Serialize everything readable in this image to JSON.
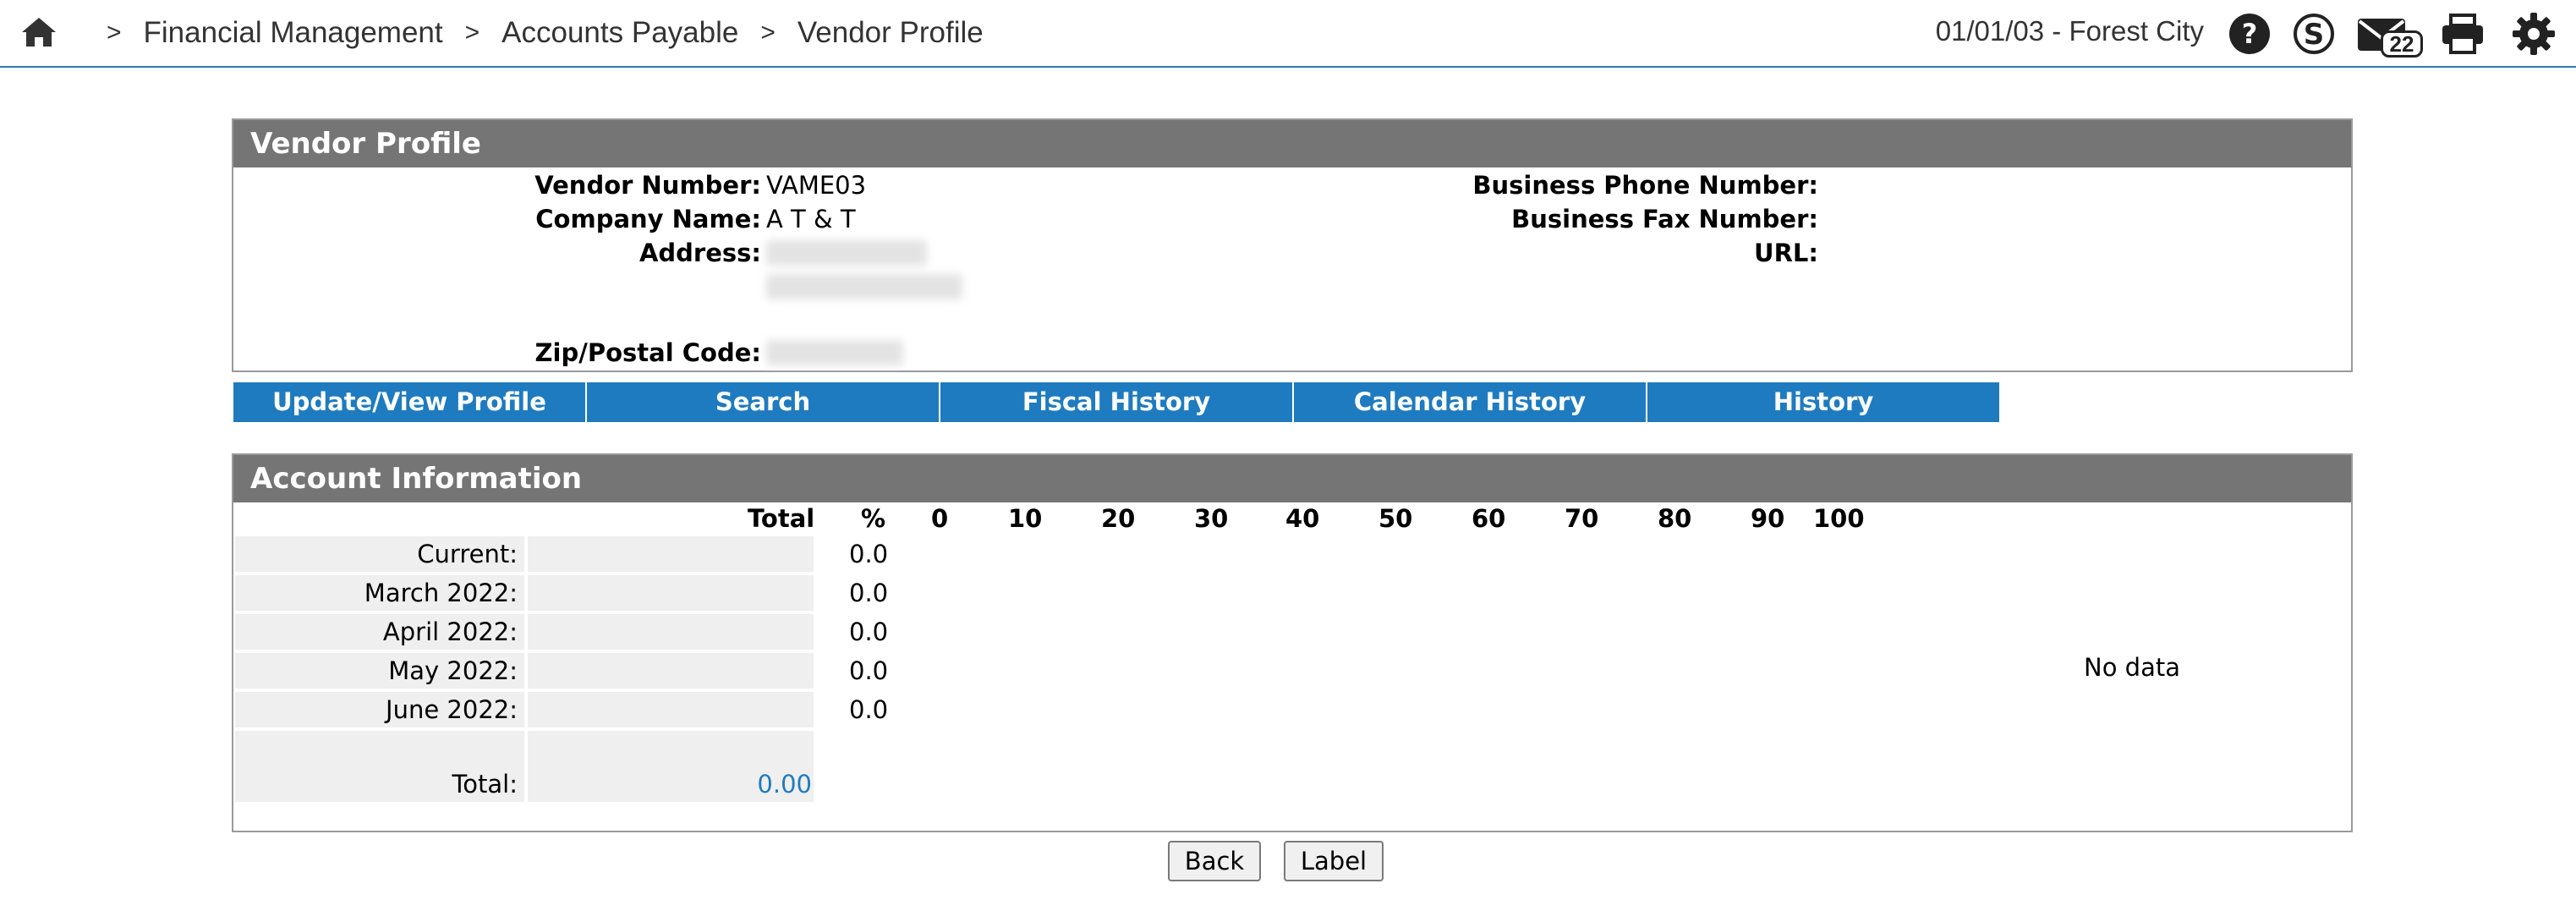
{
  "breadcrumb": {
    "items": [
      "Financial Management",
      "Accounts Payable",
      "Vendor Profile"
    ],
    "separator": ">"
  },
  "header": {
    "location": "01/01/03 - Forest City",
    "mail_count": "22",
    "icons": [
      "home-icon",
      "help-icon",
      "skyward-icon",
      "mail-icon",
      "print-icon",
      "settings-icon"
    ]
  },
  "vendor_profile": {
    "title": "Vendor Profile",
    "vendor_number_label": "Vendor Number:",
    "vendor_number": "VAME03",
    "company_name_label": "Company Name:",
    "company_name": "A T & T",
    "address_label": "Address:",
    "zip_label": "Zip/Postal Code:",
    "business_phone_label": "Business Phone Number:",
    "business_fax_label": "Business Fax Number:",
    "url_label": "URL:"
  },
  "tabs": [
    "Update/View Profile",
    "Search",
    "Fiscal History",
    "Calendar History",
    "History"
  ],
  "account_info": {
    "title": "Account Information",
    "total_header": "Total",
    "pct_header": "%",
    "scale": [
      "0",
      "10",
      "20",
      "30",
      "40",
      "50",
      "60",
      "70",
      "80",
      "90",
      "100"
    ],
    "rows": [
      {
        "label": "Current:",
        "total": "",
        "pct": "0.0"
      },
      {
        "label": "March 2022:",
        "total": "",
        "pct": "0.0"
      },
      {
        "label": "April 2022:",
        "total": "",
        "pct": "0.0"
      },
      {
        "label": "May 2022:",
        "total": "",
        "pct": "0.0"
      },
      {
        "label": "June 2022:",
        "total": "",
        "pct": "0.0"
      },
      {
        "label": "",
        "total": "",
        "pct": ""
      }
    ],
    "total_label": "Total:",
    "total_value": "0.00",
    "no_data": "No data"
  },
  "buttons": {
    "back": "Back",
    "label": "Label"
  },
  "colors": {
    "accent": "#1f7bbf",
    "panel_header": "#757575",
    "row_bg": "#efefef"
  }
}
